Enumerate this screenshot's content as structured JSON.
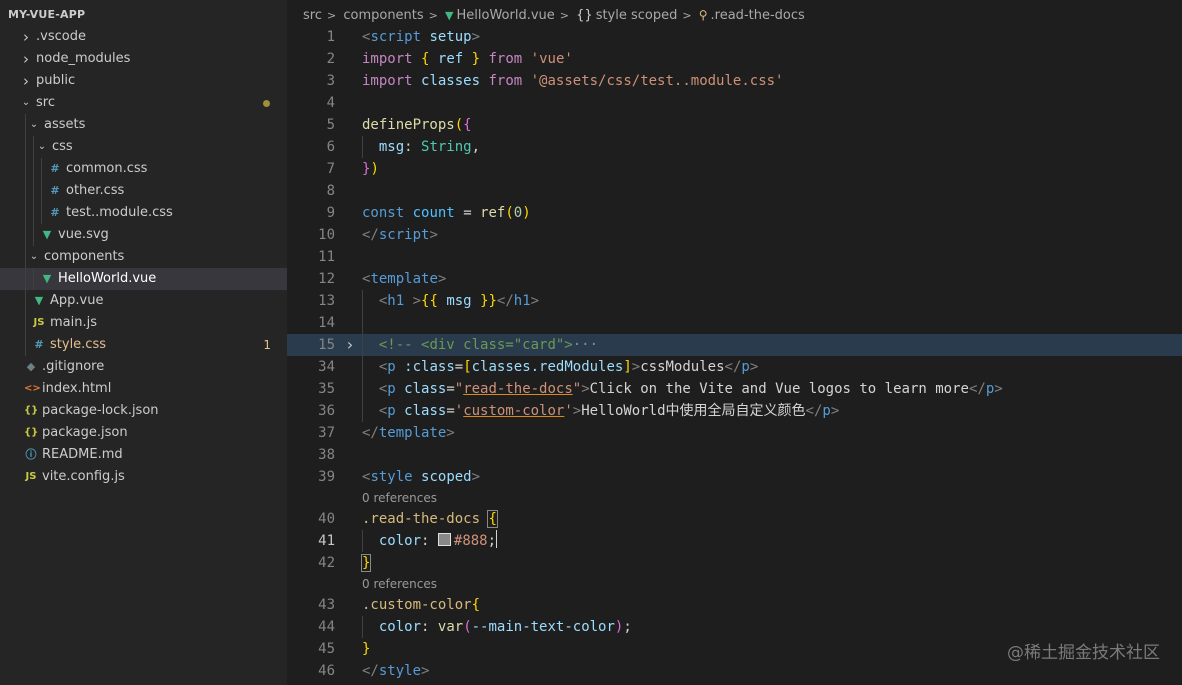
{
  "explorer": {
    "title": "MY-VUE-APP",
    "rows": [
      {
        "indent": 0,
        "chevron": "›",
        "label": ".vscode",
        "color": "#cccccc"
      },
      {
        "indent": 0,
        "chevron": "›",
        "label": "node_modules",
        "color": "#cccccc"
      },
      {
        "indent": 0,
        "chevron": "›",
        "label": "public",
        "color": "#cccccc"
      },
      {
        "indent": 0,
        "chevron": "⌄",
        "label": "src",
        "color": "#cccccc",
        "dot": "#a08e3b"
      },
      {
        "indent": 1,
        "chevron": "⌄",
        "label": "assets",
        "color": "#cccccc"
      },
      {
        "indent": 2,
        "chevron": "⌄",
        "label": "css",
        "color": "#cccccc"
      },
      {
        "indent": 3,
        "icon": "#",
        "icon_color": "#519aba",
        "icon_name": "css-file-icon",
        "label": "common.css",
        "color": "#cccccc"
      },
      {
        "indent": 3,
        "icon": "#",
        "icon_color": "#519aba",
        "icon_name": "css-file-icon",
        "label": "other.css",
        "color": "#cccccc"
      },
      {
        "indent": 3,
        "icon": "#",
        "icon_color": "#519aba",
        "icon_name": "css-file-icon",
        "label": "test..module.css",
        "color": "#cccccc"
      },
      {
        "indent": 2,
        "icon": "▼",
        "icon_color": "#41b883",
        "icon_name": "vue-file-icon",
        "label": "vue.svg",
        "color": "#cccccc"
      },
      {
        "indent": 1,
        "chevron": "⌄",
        "label": "components",
        "color": "#cccccc"
      },
      {
        "indent": 2,
        "icon": "▼",
        "icon_color": "#41b883",
        "icon_name": "vue-file-icon",
        "label": "HelloWorld.vue",
        "color": "#ffffff",
        "active": true
      },
      {
        "indent": 1,
        "icon": "▼",
        "icon_color": "#41b883",
        "icon_name": "vue-file-icon",
        "label": "App.vue",
        "color": "#cccccc"
      },
      {
        "indent": 1,
        "icon": "JS",
        "icon_color": "#cbcb41",
        "icon_name": "js-file-icon",
        "label": "main.js",
        "color": "#cccccc"
      },
      {
        "indent": 1,
        "icon": "#",
        "icon_color": "#519aba",
        "icon_name": "css-file-icon",
        "label": "style.css",
        "color": "#e2c08d",
        "badge": "1"
      },
      {
        "indent": 0,
        "icon": "◆",
        "icon_color": "#6d8086",
        "icon_name": "git-file-icon",
        "label": ".gitignore",
        "color": "#cccccc"
      },
      {
        "indent": 0,
        "icon": "<>",
        "icon_color": "#e37933",
        "icon_name": "html-file-icon",
        "label": "index.html",
        "color": "#cccccc"
      },
      {
        "indent": 0,
        "icon": "{}",
        "icon_color": "#cbcb41",
        "icon_name": "json-file-icon",
        "label": "package-lock.json",
        "color": "#cccccc"
      },
      {
        "indent": 0,
        "icon": "{}",
        "icon_color": "#cbcb41",
        "icon_name": "json-file-icon",
        "label": "package.json",
        "color": "#cccccc"
      },
      {
        "indent": 0,
        "icon": "ⓘ",
        "icon_color": "#519aba",
        "icon_name": "info-file-icon",
        "label": "README.md",
        "color": "#cccccc"
      },
      {
        "indent": 0,
        "icon": "JS",
        "icon_color": "#cbcb41",
        "icon_name": "js-file-icon",
        "label": "vite.config.js",
        "color": "#cccccc"
      }
    ]
  },
  "breadcrumb": {
    "src": "src",
    "components": "components",
    "file": "HelloWorld.vue",
    "style_icon": "{}",
    "style": "style scoped",
    "selector": ".read-the-docs"
  },
  "code": {
    "lines": [
      {
        "n": "1",
        "s": [
          [
            "<",
            "#808080"
          ],
          [
            "script",
            "#569cd6"
          ],
          [
            " ",
            ""
          ],
          [
            "setup",
            "#9cdcfe"
          ],
          [
            ">",
            "#808080"
          ]
        ]
      },
      {
        "n": "2",
        "s": [
          [
            "import",
            "#c586c0"
          ],
          [
            " ",
            ""
          ],
          [
            "{",
            "#ffd700"
          ],
          [
            " ",
            ""
          ],
          [
            "ref",
            "#9cdcfe"
          ],
          [
            " ",
            ""
          ],
          [
            "}",
            "#ffd700"
          ],
          [
            " ",
            ""
          ],
          [
            "from",
            "#c586c0"
          ],
          [
            " ",
            ""
          ],
          [
            "'vue'",
            "#ce9178"
          ]
        ]
      },
      {
        "n": "3",
        "s": [
          [
            "import",
            "#c586c0"
          ],
          [
            " ",
            ""
          ],
          [
            "classes",
            "#9cdcfe"
          ],
          [
            " ",
            ""
          ],
          [
            "from",
            "#c586c0"
          ],
          [
            " ",
            ""
          ],
          [
            "'@assets/css/test..module.css'",
            "#ce9178"
          ]
        ]
      },
      {
        "n": "4",
        "s": []
      },
      {
        "n": "5",
        "s": [
          [
            "defineProps",
            "#dcdcaa"
          ],
          [
            "(",
            "#ffd700"
          ],
          [
            "{",
            "#da70d6"
          ]
        ]
      },
      {
        "n": "6",
        "g": 1,
        "s": [
          [
            "  ",
            ""
          ],
          [
            "msg",
            "#9cdcfe"
          ],
          [
            ": ",
            "#d4d4d4"
          ],
          [
            "String",
            "#4ec9b0"
          ],
          [
            ",",
            "#d4d4d4"
          ]
        ]
      },
      {
        "n": "7",
        "s": [
          [
            "}",
            "#da70d6"
          ],
          [
            ")",
            "#ffd700"
          ]
        ]
      },
      {
        "n": "8",
        "s": []
      },
      {
        "n": "9",
        "s": [
          [
            "const",
            "#569cd6"
          ],
          [
            " ",
            ""
          ],
          [
            "count",
            "#4fc1ff"
          ],
          [
            " ",
            "#d4d4d4"
          ],
          [
            "=",
            "#d4d4d4"
          ],
          [
            " ",
            ""
          ],
          [
            "ref",
            "#dcdcaa"
          ],
          [
            "(",
            "#ffd700"
          ],
          [
            "0",
            "#b5cea8"
          ],
          [
            ")",
            "#ffd700"
          ]
        ]
      },
      {
        "n": "10",
        "s": [
          [
            "</",
            "#808080"
          ],
          [
            "script",
            "#569cd6"
          ],
          [
            ">",
            "#808080"
          ]
        ]
      },
      {
        "n": "11",
        "s": []
      },
      {
        "n": "12",
        "s": [
          [
            "<",
            "#808080"
          ],
          [
            "template",
            "#569cd6"
          ],
          [
            ">",
            "#808080"
          ]
        ]
      },
      {
        "n": "13",
        "g": 1,
        "s": [
          [
            "  ",
            ""
          ],
          [
            "<",
            "#808080"
          ],
          [
            "h1",
            "#569cd6"
          ],
          [
            " ",
            ""
          ],
          [
            ">",
            "#808080"
          ],
          [
            "{{",
            "#ffd700"
          ],
          [
            " ",
            ""
          ],
          [
            "msg",
            "#9cdcfe"
          ],
          [
            " ",
            ""
          ],
          [
            "}}",
            "#ffd700"
          ],
          [
            "</",
            "#808080"
          ],
          [
            "h1",
            "#569cd6"
          ],
          [
            ">",
            "#808080"
          ]
        ]
      },
      {
        "n": "14",
        "g": 1,
        "s": []
      },
      {
        "n": "15",
        "g": 1,
        "hl": true,
        "fold": "›",
        "s": [
          [
            "  ",
            ""
          ],
          [
            "<!-- ",
            "#6a9955"
          ],
          [
            "<div class=\"card\">",
            "#6a9955"
          ],
          [
            "···",
            "#8c8c8c"
          ]
        ]
      },
      {
        "n": "34",
        "g": 1,
        "s": [
          [
            "  ",
            ""
          ],
          [
            "<",
            "#808080"
          ],
          [
            "p",
            "#569cd6"
          ],
          [
            " ",
            ""
          ],
          [
            ":class",
            "#9cdcfe"
          ],
          [
            "=",
            "#d4d4d4"
          ],
          [
            "[",
            "#ffd700"
          ],
          [
            "classes.redModules",
            "#9cdcfe"
          ],
          [
            "]",
            "#ffd700"
          ],
          [
            ">",
            "#808080"
          ],
          [
            "cssModules",
            "#d4d4d4"
          ],
          [
            "</",
            "#808080"
          ],
          [
            "p",
            "#569cd6"
          ],
          [
            ">",
            "#808080"
          ]
        ]
      },
      {
        "n": "35",
        "g": 1,
        "s": [
          [
            "  ",
            ""
          ],
          [
            "<",
            "#808080"
          ],
          [
            "p",
            "#569cd6"
          ],
          [
            " ",
            ""
          ],
          [
            "class",
            "#9cdcfe"
          ],
          [
            "=",
            "#d4d4d4"
          ],
          [
            "\"",
            "#ce9178"
          ],
          [
            "read-the-docs",
            "#ce9178",
            "sq"
          ],
          [
            "\"",
            "#ce9178"
          ],
          [
            ">",
            "#808080"
          ],
          [
            "Click on the Vite and Vue logos to learn more",
            "#d4d4d4"
          ],
          [
            "</",
            "#808080"
          ],
          [
            "p",
            "#569cd6"
          ],
          [
            ">",
            "#808080"
          ]
        ]
      },
      {
        "n": "36",
        "g": 1,
        "s": [
          [
            "  ",
            ""
          ],
          [
            "<",
            "#808080"
          ],
          [
            "p",
            "#569cd6"
          ],
          [
            " ",
            ""
          ],
          [
            "class",
            "#9cdcfe"
          ],
          [
            "=",
            "#d4d4d4"
          ],
          [
            "'",
            "#ce9178"
          ],
          [
            "custom-color",
            "#ce9178",
            "sq"
          ],
          [
            "'",
            "#ce9178"
          ],
          [
            ">",
            "#808080"
          ],
          [
            "HelloWorld中使用全局自定义颜色",
            "#d4d4d4"
          ],
          [
            "</",
            "#808080"
          ],
          [
            "p",
            "#569cd6"
          ],
          [
            ">",
            "#808080"
          ]
        ]
      },
      {
        "n": "37",
        "s": [
          [
            "</",
            "#808080"
          ],
          [
            "template",
            "#569cd6"
          ],
          [
            ">",
            "#808080"
          ]
        ]
      },
      {
        "n": "38",
        "s": []
      },
      {
        "n": "39",
        "s": [
          [
            "<",
            "#808080"
          ],
          [
            "style",
            "#569cd6"
          ],
          [
            " ",
            ""
          ],
          [
            "scoped",
            "#9cdcfe"
          ],
          [
            ">",
            "#808080"
          ]
        ]
      },
      {
        "lens": "0 references"
      },
      {
        "n": "40",
        "s": [
          [
            ".read-the-docs",
            "#d7ba7d"
          ],
          [
            " ",
            ""
          ],
          [
            "{",
            "#ffd700",
            "box"
          ]
        ]
      },
      {
        "n": "41",
        "g": 1,
        "cur": true,
        "s": [
          [
            "  ",
            ""
          ],
          [
            "color",
            "#9cdcfe"
          ],
          [
            ":",
            "#d4d4d4"
          ],
          [
            " ",
            ""
          ],
          [
            "swatch",
            ""
          ],
          [
            "#888",
            "#ce9178"
          ],
          [
            ";",
            "#d4d4d4"
          ],
          [
            "caret",
            ""
          ]
        ]
      },
      {
        "n": "42",
        "s": [
          [
            "}",
            "#ffd700",
            "box"
          ]
        ]
      },
      {
        "lens": "0 references"
      },
      {
        "n": "43",
        "s": [
          [
            ".custom-color",
            "#d7ba7d"
          ],
          [
            "{",
            "#ffd700"
          ]
        ]
      },
      {
        "n": "44",
        "g": 1,
        "s": [
          [
            "  ",
            ""
          ],
          [
            "color",
            "#9cdcfe"
          ],
          [
            ":",
            "#d4d4d4"
          ],
          [
            " ",
            ""
          ],
          [
            "var",
            "#dcdcaa"
          ],
          [
            "(",
            "#da70d6"
          ],
          [
            "--main-text-color",
            "#9cdcfe"
          ],
          [
            ")",
            "#da70d6"
          ],
          [
            ";",
            "#d4d4d4"
          ]
        ]
      },
      {
        "n": "45",
        "s": [
          [
            "}",
            "#ffd700"
          ]
        ]
      },
      {
        "n": "46",
        "s": [
          [
            "</",
            "#808080"
          ],
          [
            "style",
            "#569cd6"
          ],
          [
            ">",
            "#808080"
          ]
        ]
      }
    ]
  },
  "watermark": "@稀土掘金技术社区"
}
